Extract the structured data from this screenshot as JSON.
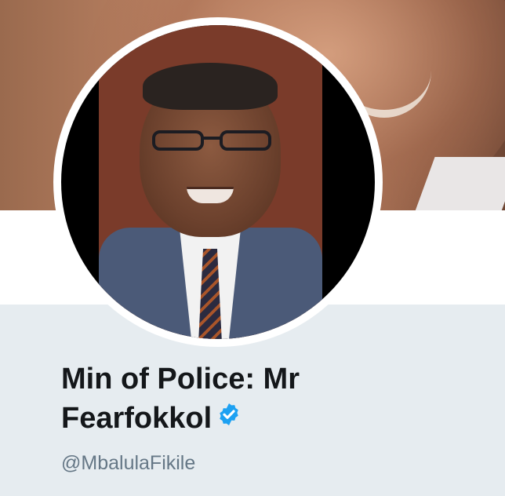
{
  "profile": {
    "name_line1": "Min of Police: Mr",
    "name_line2": "Fearfokkol",
    "screen_name": "@MbalulaFikile",
    "verified": true
  },
  "icons": {
    "verified": "verified-badge-icon"
  },
  "colors": {
    "background": "#e6ecf0",
    "name_text": "#14171a",
    "screen_name_text": "#657786",
    "verified_badge": "#1da1f2"
  }
}
